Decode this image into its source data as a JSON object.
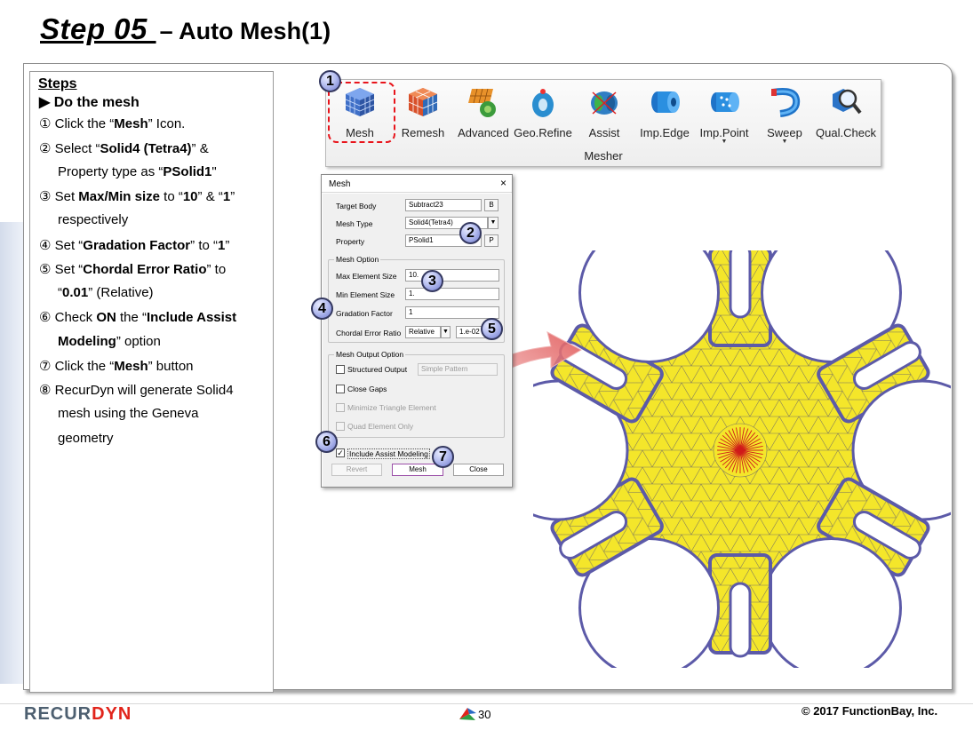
{
  "slide": {
    "title_step": "Step 05 ",
    "title_rest": "– Auto Mesh(1)"
  },
  "steps": {
    "heading": "Steps",
    "subheading": "▶ Do the mesh",
    "lines": [
      {
        "pre": "① Click the “",
        "bold": "Mesh",
        "post": "” Icon."
      },
      {
        "pre": "② Select “",
        "bold": "Solid4 (Tetra4)",
        "post": "” &"
      },
      {
        "pre": "Property type as “",
        "bold": "PSolid1",
        "post": "\""
      },
      {
        "pre": "③ Set ",
        "bold": "Max/Min size",
        "post": "  to “",
        "bold2": "10",
        "post2": "” & “",
        "bold3": "1",
        "post3": "”"
      },
      {
        "pre": "respectively",
        "bold": "",
        "post": ""
      },
      {
        "pre": "④ Set “",
        "bold": "Gradation Factor",
        "post": "” to “",
        "bold2": "1",
        "post2": "”"
      },
      {
        "pre": "⑤ Set “",
        "bold": "Chordal Error Ratio",
        "post": "” to"
      },
      {
        "pre": "“",
        "bold": "0.01",
        "post": "” (Relative)"
      },
      {
        "pre": "⑥ Check ",
        "bold": "ON",
        "post": " the “",
        "bold2": "Include Assist",
        "post2": ""
      },
      {
        "pre": "",
        "bold": "Modeling",
        "post": "” option"
      },
      {
        "pre": "⑦ Click the “",
        "bold": "Mesh",
        "post": "” button"
      },
      {
        "pre": "⑧ RecurDyn will generate Solid4",
        "bold": "",
        "post": ""
      },
      {
        "pre": "mesh using the Geneva",
        "bold": "",
        "post": ""
      },
      {
        "pre": "geometry",
        "bold": "",
        "post": ""
      }
    ]
  },
  "toolbar": {
    "group_label": "Mesher",
    "tools": [
      {
        "label": "Mesh",
        "icon": "mesh-cube-icon"
      },
      {
        "label": "Remesh",
        "icon": "remesh-cube-icon"
      },
      {
        "label": "Advanced",
        "icon": "advanced-mesh-icon"
      },
      {
        "label": "Geo.Refine",
        "icon": "geo-refine-icon"
      },
      {
        "label": "Assist",
        "icon": "assist-icon"
      },
      {
        "label": "Imp.Edge",
        "icon": "imp-edge-icon"
      },
      {
        "label": "Imp.Point",
        "icon": "imp-point-icon"
      },
      {
        "label": "Sweep",
        "icon": "sweep-icon"
      },
      {
        "label": "Qual.Check",
        "icon": "qual-check-icon"
      }
    ]
  },
  "dialog": {
    "title": "Mesh",
    "close": "×",
    "target_body_label": "Target Body",
    "target_body_value": "Subtract23",
    "target_body_btn": "B",
    "mesh_type_label": "Mesh Type",
    "mesh_type_value": "Solid4(Tetra4)",
    "property_label": "Property",
    "property_value": "PSolid1",
    "property_btn": "P",
    "mesh_option_title": "Mesh Option",
    "max_size_label": "Max Element Size",
    "max_size_value": "10.",
    "min_size_label": "Min Element Size",
    "min_size_value": "1.",
    "gradation_label": "Gradation Factor",
    "gradation_value": "1",
    "chordal_label": "Chordal Error Ratio",
    "chordal_mode": "Relative",
    "chordal_value": "1.e-02",
    "output_title": "Mesh Output Option",
    "structured_label": "Structured Output",
    "structured_select": "Simple Pattern",
    "close_gaps_label": "Close Gaps",
    "minimize_label": "Minimize Triangle Element",
    "quad_label": "Quad Element Only",
    "assist_label": "Include Assist Modeling",
    "revert_btn": "Revert",
    "mesh_btn": "Mesh",
    "close_btn": "Close"
  },
  "badges": [
    "1",
    "2",
    "3",
    "4",
    "5",
    "6",
    "7"
  ],
  "footer": {
    "brand_main": "RECUR",
    "brand_accent": "DYN",
    "page": "30",
    "copyright": "© 2017 FunctionBay, Inc."
  },
  "colors": {
    "mesh_fill": "#f4e62a",
    "mesh_edge": "#5c5aa8",
    "highlight": "#e8141b",
    "arrow": "#f0a0a0"
  }
}
